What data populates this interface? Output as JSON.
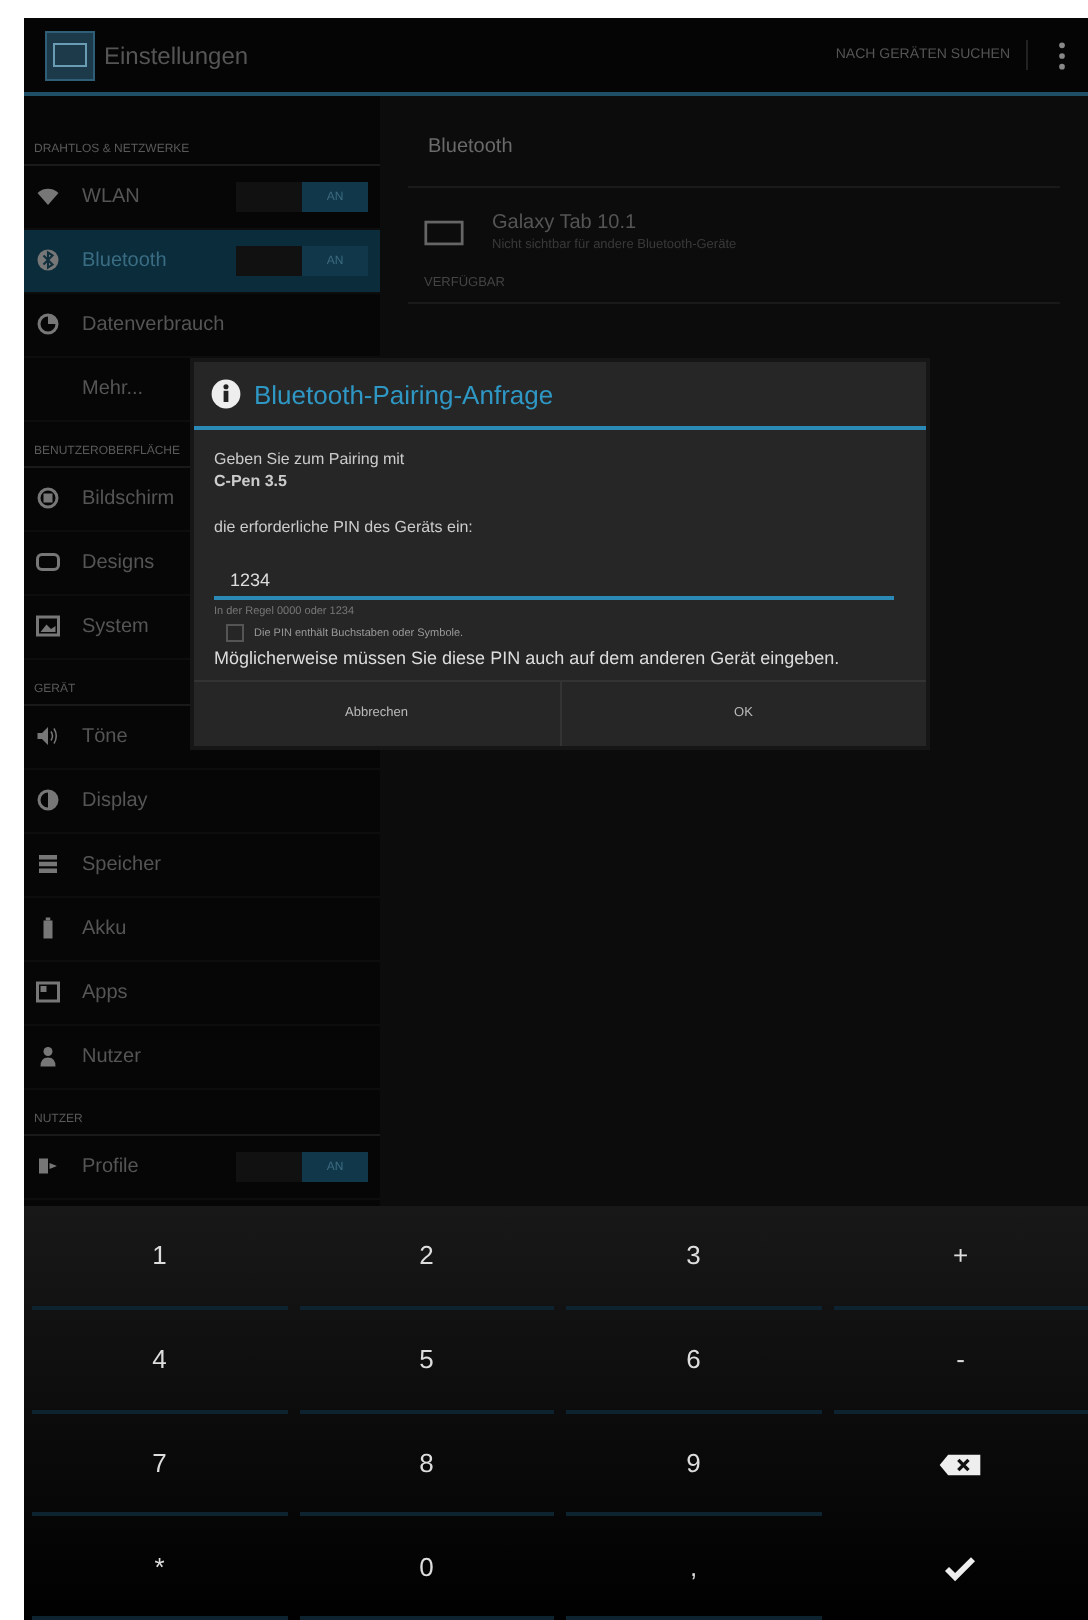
{
  "action_bar": {
    "title": "Einstellungen",
    "action": "NACH GERÄTEN SUCHEN"
  },
  "sidebar": {
    "sections": [
      {
        "header": "DRAHTLOS & NETZWERKE",
        "items": [
          {
            "label": "WLAN",
            "selected": false,
            "toggle": {
              "label": "AN",
              "on": true
            }
          },
          {
            "label": "Bluetooth",
            "selected": true,
            "toggle": {
              "label": "AN",
              "on": true
            }
          },
          {
            "label": "Datenverbrauch",
            "selected": false
          },
          {
            "label": "Mehr...",
            "selected": false
          }
        ]
      },
      {
        "header": "BENUTZEROBERFLÄCHE",
        "items": [
          {
            "label": "Bildschirm",
            "selected": false
          },
          {
            "label": "Designs",
            "selected": false
          },
          {
            "label": "System",
            "selected": false
          }
        ]
      },
      {
        "header": "GERÄT",
        "items": [
          {
            "label": "Töne",
            "selected": false
          },
          {
            "label": "Display",
            "selected": false
          },
          {
            "label": "Speicher",
            "selected": false
          },
          {
            "label": "Akku",
            "selected": false
          },
          {
            "label": "Apps",
            "selected": false
          },
          {
            "label": "Nutzer",
            "selected": false
          }
        ]
      },
      {
        "header": "NUTZER",
        "items": [
          {
            "label": "Profile",
            "selected": false,
            "toggle": {
              "label": "AN",
              "on": true
            }
          }
        ]
      }
    ]
  },
  "content": {
    "title": "Bluetooth",
    "device": {
      "name": "Galaxy Tab 10.1",
      "status": "Nicht sichtbar für andere Bluetooth-Geräte"
    },
    "section": "VERFÜGBAR"
  },
  "dialog": {
    "title": "Bluetooth-Pairing-Anfrage",
    "intro": "Geben Sie zum Pairing mit",
    "device": "C-Pen 3.5",
    "instruction": "die erforderliche PIN des Geräts ein:",
    "pin": "1234",
    "hint": "In der Regel 0000 oder 1234",
    "checkbox": {
      "label": "Die PIN enthält Buchstaben oder Symbole.",
      "checked": false
    },
    "note": "Möglicherweise müssen Sie diese PIN auch auf dem anderen Gerät eingeben.",
    "buttons": [
      "Abbrechen",
      "OK"
    ]
  },
  "keyboard": {
    "keys": [
      {
        "kind": "char",
        "label": "1"
      },
      {
        "kind": "char",
        "label": "2"
      },
      {
        "kind": "char",
        "label": "3"
      },
      {
        "kind": "char",
        "label": "+"
      },
      {
        "kind": "char",
        "label": "4"
      },
      {
        "kind": "char",
        "label": "5"
      },
      {
        "kind": "char",
        "label": "6"
      },
      {
        "kind": "char",
        "label": "-"
      },
      {
        "kind": "char",
        "label": "7"
      },
      {
        "kind": "char",
        "label": "8"
      },
      {
        "kind": "char",
        "label": "9"
      },
      {
        "kind": "backspace"
      },
      {
        "kind": "char",
        "label": "*"
      },
      {
        "kind": "char",
        "label": "0"
      },
      {
        "kind": "char",
        "label": ","
      },
      {
        "kind": "done"
      }
    ]
  }
}
